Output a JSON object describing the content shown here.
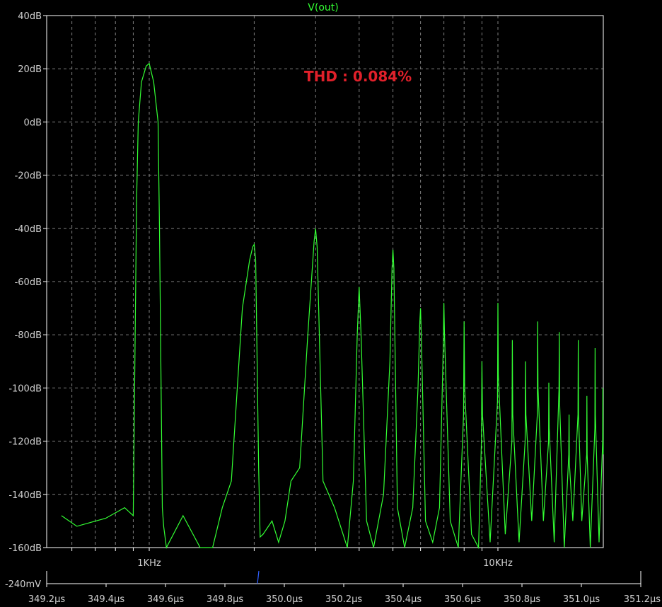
{
  "chart_data": {
    "type": "line",
    "title": "V(out)",
    "annotation": "THD : 0.084%",
    "x_scale": "log",
    "y_unit": "dB",
    "ylim": [
      -160,
      40
    ],
    "y_ticks": [
      40,
      20,
      0,
      -20,
      -40,
      -60,
      -80,
      -100,
      -120,
      -140,
      -160
    ],
    "y_tick_labels": [
      "40dB",
      "20dB",
      "0dB",
      "-20dB",
      "-40dB",
      "-60dB",
      "-80dB",
      "-100dB",
      "-120dB",
      "-140dB",
      "-160dB"
    ],
    "x_labeled_ticks": [
      "1KHz",
      "10KHz"
    ],
    "grid": true,
    "colors": {
      "trace": "#33ff33",
      "grid": "#808080",
      "annotation": "#e0202a",
      "axis": "#ffffff",
      "text": "#d0d0d0"
    },
    "series": [
      {
        "x_khz": [
          0.56,
          0.62,
          0.75,
          0.85,
          0.9,
          0.92,
          0.93,
          0.95,
          0.98,
          1.0,
          1.03,
          1.06,
          1.07,
          1.09,
          1.1,
          1.12,
          1.25,
          1.4,
          1.52,
          1.62,
          1.72,
          1.85,
          1.94,
          1.98,
          2.0,
          2.02,
          2.06,
          2.08,
          2.12,
          2.25,
          2.35,
          2.45,
          2.55,
          2.7,
          2.85,
          2.97,
          3.0,
          3.03,
          3.15,
          3.4,
          3.7,
          3.85,
          3.95,
          4.0,
          4.05,
          4.2,
          4.4,
          4.7,
          4.9,
          4.97,
          5.0,
          5.03,
          5.15,
          5.4,
          5.7,
          5.9,
          5.97,
          6.0,
          6.03,
          6.2,
          6.5,
          6.8,
          6.97,
          7.0,
          7.03,
          7.3,
          7.7,
          7.97,
          8.0,
          8.03,
          8.4,
          8.8,
          8.97,
          9.0,
          9.03,
          9.5,
          9.97,
          10.0,
          10.03,
          10.5,
          10.97,
          11.0,
          11.03,
          11.5,
          11.97,
          12.0,
          12.03,
          12.5,
          12.97,
          13.0,
          13.03,
          13.5,
          13.97,
          14.0,
          14.03,
          14.5,
          14.97,
          15.0,
          15.03,
          15.5,
          15.97,
          16.0,
          16.03,
          16.4,
          16.97,
          17.0,
          17.03,
          17.4,
          17.97,
          18.0,
          18.03,
          18.4,
          18.97,
          19.0,
          19.03,
          19.5,
          19.97,
          20.0,
          20.03,
          20.3
        ],
        "db": [
          -148,
          -152,
          -149,
          -145,
          -148,
          -30,
          0,
          15,
          21,
          22,
          15,
          0,
          -40,
          -145,
          -152,
          -166,
          -148,
          -166,
          -162,
          -145,
          -135,
          -70,
          -52,
          -47,
          -46,
          -52,
          -130,
          -156,
          -155,
          -150,
          -158,
          -150,
          -135,
          -130,
          -80,
          -45,
          -40,
          -47,
          -135,
          -145,
          -160,
          -135,
          -80,
          -62,
          -80,
          -150,
          -160,
          -140,
          -90,
          -55,
          -48,
          -55,
          -145,
          -160,
          -145,
          -100,
          -75,
          -70,
          -80,
          -150,
          -158,
          -145,
          -85,
          -68,
          -80,
          -150,
          -160,
          -110,
          -75,
          -100,
          -155,
          -160,
          -120,
          -90,
          -110,
          -158,
          -105,
          -68,
          -95,
          -155,
          -120,
          -82,
          -110,
          -158,
          -120,
          -90,
          -110,
          -150,
          -110,
          -75,
          -100,
          -150,
          -120,
          -98,
          -115,
          -158,
          -100,
          -79,
          -105,
          -160,
          -125,
          -110,
          -128,
          -150,
          -110,
          -82,
          -110,
          -150,
          -125,
          -103,
          -125,
          -160,
          -115,
          -85,
          -110,
          -158,
          -120,
          -100,
          -120,
          -125
        ]
      }
    ],
    "time_axis": {
      "label": "-240mV",
      "tick_labels": [
        "349.2µs",
        "349.4µs",
        "349.6µs",
        "349.8µs",
        "350.0µs",
        "350.2µs",
        "350.4µs",
        "350.6µs",
        "350.8µs",
        "351.0µs",
        "351.2µs"
      ]
    }
  }
}
